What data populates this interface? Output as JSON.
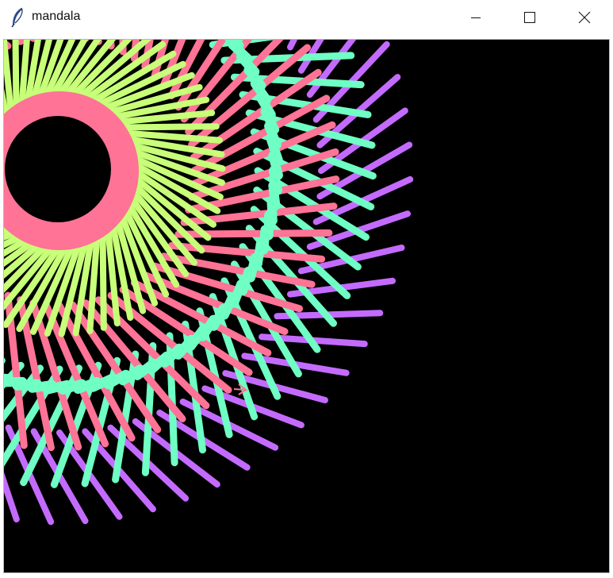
{
  "window": {
    "title": "mandala",
    "icon": "feather-icon",
    "controls": {
      "minimize_icon": "minimize-icon",
      "maximize_icon": "maximize-icon",
      "close_icon": "close-icon"
    }
  },
  "canvas": {
    "background": "#000000",
    "colors": {
      "center_ring": "#ff7396",
      "inner_lines": "#c8ff78",
      "mint_lines": "#6fffc4",
      "pink_lines": "#ff7396",
      "violet_lines": "#c46bff"
    },
    "turtle_cursor": "turtle-arrow-icon"
  }
}
